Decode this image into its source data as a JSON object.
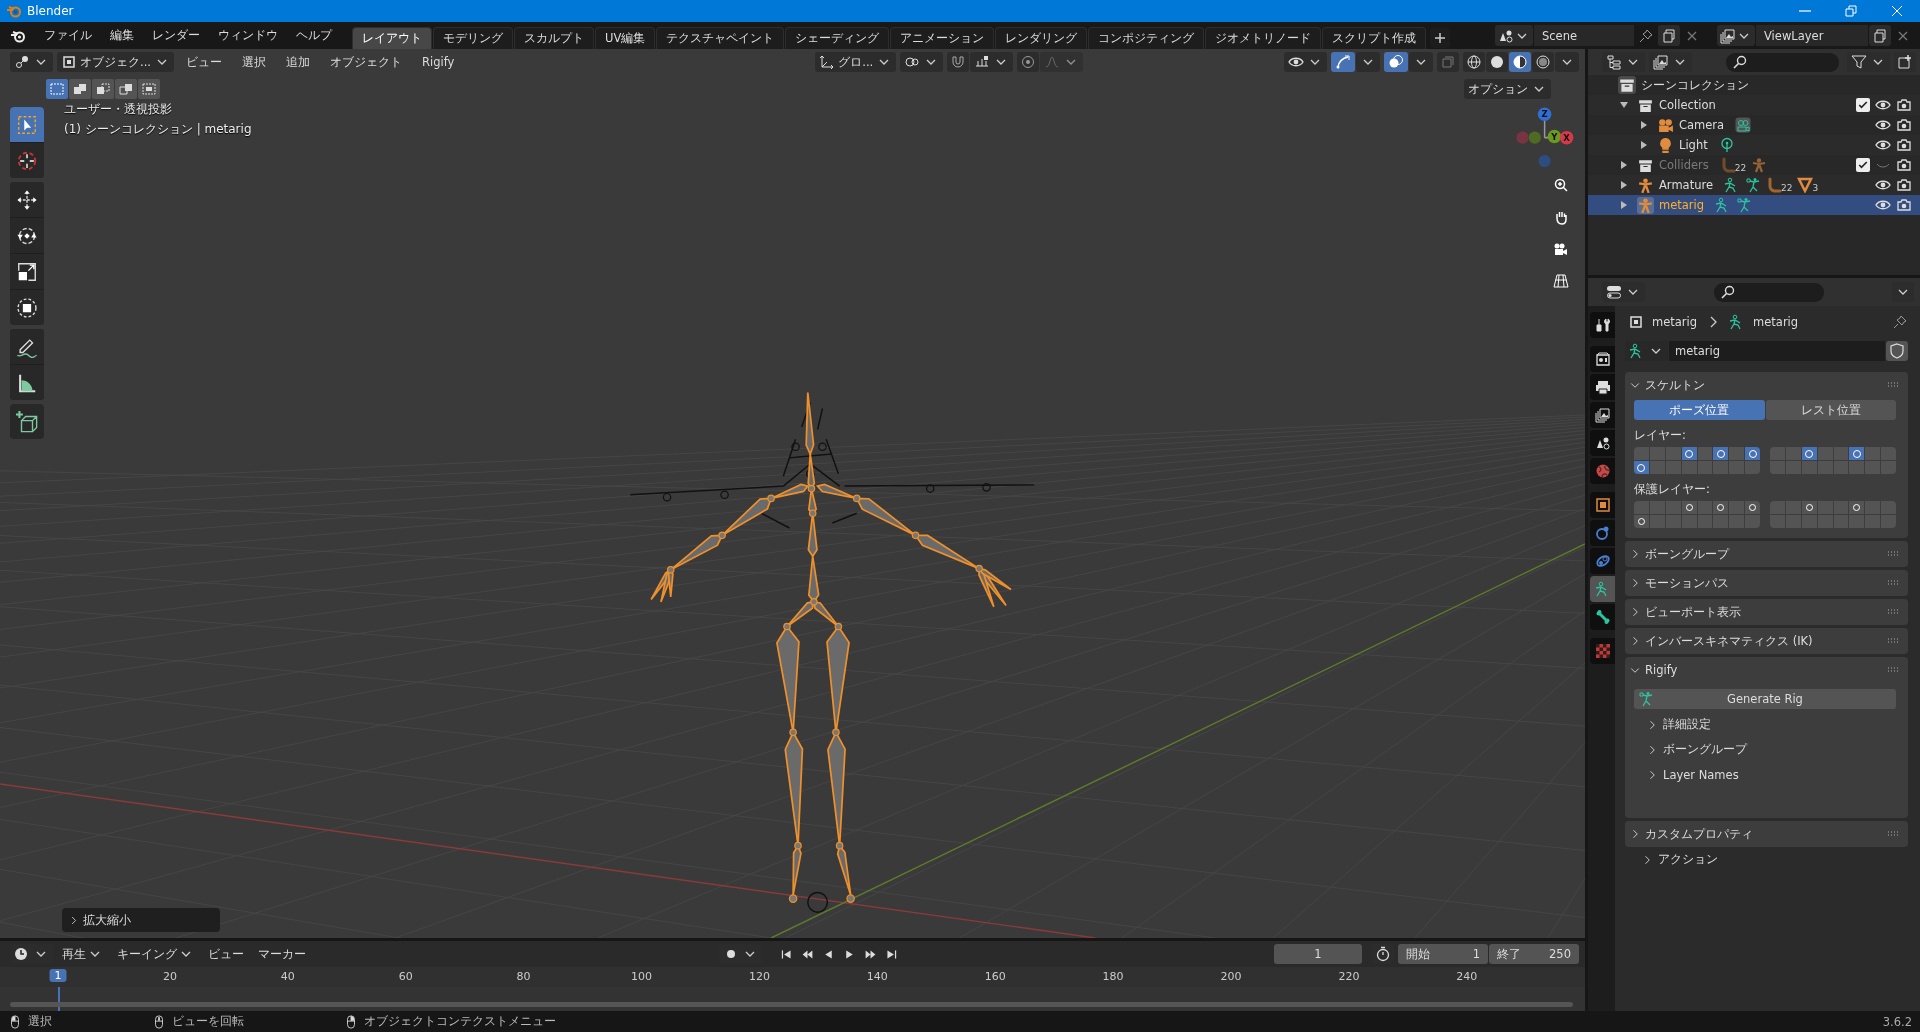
{
  "window": {
    "title": "Blender"
  },
  "menu": [
    "ファイル",
    "編集",
    "レンダー",
    "ウィンドウ",
    "ヘルプ"
  ],
  "workspace_tabs": [
    {
      "label": "レイアウト",
      "selected": true
    },
    {
      "label": "モデリング",
      "selected": false
    },
    {
      "label": "スカルプト",
      "selected": false
    },
    {
      "label": "UV編集",
      "selected": false
    },
    {
      "label": "テクスチャペイント",
      "selected": false
    },
    {
      "label": "シェーディング",
      "selected": false
    },
    {
      "label": "アニメーション",
      "selected": false
    },
    {
      "label": "レンダリング",
      "selected": false
    },
    {
      "label": "コンポジティング",
      "selected": false
    },
    {
      "label": "ジオメトリノード",
      "selected": false
    },
    {
      "label": "スクリプト作成",
      "selected": false
    }
  ],
  "scene": "Scene",
  "view_layer": "ViewLayer",
  "viewport": {
    "mode": "オブジェク...",
    "menus": [
      "ビュー",
      "選択",
      "追加",
      "オブジェクト",
      "Rigify"
    ],
    "orientation": "グロ...",
    "options": "オプション",
    "select_modes": [
      {
        "kind": "new",
        "selected": true
      },
      {
        "kind": "extend",
        "selected": false
      },
      {
        "kind": "subtract",
        "selected": false
      },
      {
        "kind": "invert",
        "selected": false
      },
      {
        "kind": "intersect",
        "selected": false
      }
    ],
    "shading_modes": [
      {
        "kind": "wireframe",
        "selected": false
      },
      {
        "kind": "solid",
        "selected": false
      },
      {
        "kind": "material",
        "selected": true
      },
      {
        "kind": "rendered",
        "selected": false
      }
    ],
    "view_name": "ユーザー・透視投影",
    "context": "(1) シーンコレクション | metarig",
    "last_operator": "拡大縮小",
    "gizmo_axes": [
      {
        "label": "Z",
        "color": "#2f6fd6"
      },
      {
        "label": "Y",
        "color": "#6a9a1f"
      },
      {
        "label": "X",
        "color": "#d63a4a"
      }
    ],
    "tool_groups": [
      [
        {
          "kind": "select",
          "selected": true
        },
        {
          "kind": "cursor",
          "selected": false
        }
      ],
      [
        {
          "kind": "move",
          "selected": false
        },
        {
          "kind": "rotate",
          "selected": false
        },
        {
          "kind": "scale",
          "selected": false
        },
        {
          "kind": "transform",
          "selected": false
        }
      ],
      [
        {
          "kind": "annotate",
          "selected": false
        },
        {
          "kind": "measure",
          "selected": false
        }
      ],
      [
        {
          "kind": "add-cube",
          "selected": false
        }
      ]
    ]
  },
  "outliner": {
    "root": "シーンコレクション",
    "items": [
      {
        "name": "Collection",
        "kind": "collection",
        "expanded": true,
        "selected": false,
        "disabled": false,
        "checked": true,
        "visible": true,
        "children": [
          {
            "name": "Camera",
            "kind": "camera",
            "expanded": false,
            "selected": false,
            "disabled": false,
            "visible": true,
            "badges": [
              {
                "kind": "camera-data"
              }
            ]
          },
          {
            "name": "Light",
            "kind": "light",
            "expanded": false,
            "selected": false,
            "disabled": false,
            "visible": true,
            "badges": [
              {
                "kind": "light-data"
              }
            ]
          }
        ]
      },
      {
        "name": "Colliders",
        "kind": "collection",
        "expanded": false,
        "selected": false,
        "disabled": true,
        "checked": true,
        "visible": false,
        "badges": [
          {
            "kind": "bone",
            "count": "22"
          },
          {
            "kind": "armature"
          }
        ]
      },
      {
        "name": "Armature",
        "kind": "armature",
        "expanded": false,
        "selected": false,
        "disabled": false,
        "visible": true,
        "badges": [
          {
            "kind": "armature-data"
          },
          {
            "kind": "pose"
          },
          {
            "kind": "bone",
            "count": "22"
          },
          {
            "kind": "mesh",
            "count": "3"
          }
        ]
      },
      {
        "name": "metarig",
        "kind": "armature",
        "expanded": false,
        "selected": true,
        "disabled": false,
        "visible": true,
        "badges": [
          {
            "kind": "armature-data"
          },
          {
            "kind": "pose"
          }
        ]
      }
    ]
  },
  "properties": {
    "tab_groups": [
      [
        {
          "kind": "tool",
          "selected": false
        }
      ],
      [
        {
          "kind": "render",
          "selected": false
        },
        {
          "kind": "output",
          "selected": false
        },
        {
          "kind": "view-layer",
          "selected": false
        },
        {
          "kind": "scene",
          "selected": false
        },
        {
          "kind": "world",
          "selected": false
        }
      ],
      [
        {
          "kind": "object",
          "selected": false
        },
        {
          "kind": "physics",
          "selected": false
        },
        {
          "kind": "constraints",
          "selected": false
        },
        {
          "kind": "armature-data",
          "selected": true
        },
        {
          "kind": "bone",
          "selected": false
        }
      ],
      [
        {
          "kind": "texture",
          "selected": false
        }
      ]
    ],
    "breadcrumb": [
      "metarig",
      "metarig"
    ],
    "datablock": "metarig",
    "panels": [
      {
        "kind": "skeleton",
        "label": "スケルトン",
        "expanded": true,
        "position_toggle": [
          {
            "label": "ポーズ位置",
            "selected": true
          },
          {
            "label": "レスト位置",
            "selected": false
          }
        ],
        "layers_label": "レイヤー:",
        "layers": [
          [
            {
              "on": false,
              "used": false
            },
            {
              "on": false,
              "used": false
            },
            {
              "on": false,
              "used": false
            },
            {
              "on": true,
              "used": true
            },
            {
              "on": false,
              "used": false
            },
            {
              "on": true,
              "used": true
            },
            {
              "on": false,
              "used": false
            },
            {
              "on": true,
              "used": true
            },
            {
              "on": true,
              "used": true
            },
            {
              "on": false,
              "used": false
            },
            {
              "on": false,
              "used": false
            },
            {
              "on": false,
              "used": false
            },
            {
              "on": false,
              "used": false
            },
            {
              "on": false,
              "used": false
            },
            {
              "on": false,
              "used": false
            },
            {
              "on": false,
              "used": false
            }
          ],
          [
            {
              "on": false,
              "used": false
            },
            {
              "on": false,
              "used": false
            },
            {
              "on": true,
              "used": true
            },
            {
              "on": false,
              "used": false
            },
            {
              "on": false,
              "used": false
            },
            {
              "on": true,
              "used": true
            },
            {
              "on": false,
              "used": false
            },
            {
              "on": false,
              "used": false
            },
            {
              "on": false,
              "used": false
            },
            {
              "on": false,
              "used": false
            },
            {
              "on": false,
              "used": false
            },
            {
              "on": false,
              "used": false
            },
            {
              "on": false,
              "used": false
            },
            {
              "on": false,
              "used": false
            },
            {
              "on": false,
              "used": false
            },
            {
              "on": false,
              "used": false
            }
          ]
        ],
        "protected_label": "保護レイヤー:",
        "protected_layers": [
          [
            {
              "on": false,
              "used": false
            },
            {
              "on": false,
              "used": false
            },
            {
              "on": false,
              "used": false
            },
            {
              "on": false,
              "used": true
            },
            {
              "on": false,
              "used": false
            },
            {
              "on": false,
              "used": true
            },
            {
              "on": false,
              "used": false
            },
            {
              "on": false,
              "used": true
            },
            {
              "on": false,
              "used": true
            },
            {
              "on": false,
              "used": false
            },
            {
              "on": false,
              "used": false
            },
            {
              "on": false,
              "used": false
            },
            {
              "on": false,
              "used": false
            },
            {
              "on": false,
              "used": false
            },
            {
              "on": false,
              "used": false
            },
            {
              "on": false,
              "used": false
            }
          ],
          [
            {
              "on": false,
              "used": false
            },
            {
              "on": false,
              "used": false
            },
            {
              "on": false,
              "used": true
            },
            {
              "on": false,
              "used": false
            },
            {
              "on": false,
              "used": false
            },
            {
              "on": false,
              "used": true
            },
            {
              "on": false,
              "used": false
            },
            {
              "on": false,
              "used": false
            },
            {
              "on": false,
              "used": false
            },
            {
              "on": false,
              "used": false
            },
            {
              "on": false,
              "used": false
            },
            {
              "on": false,
              "used": false
            },
            {
              "on": false,
              "used": false
            },
            {
              "on": false,
              "used": false
            },
            {
              "on": false,
              "used": false
            },
            {
              "on": false,
              "used": false
            }
          ]
        ]
      },
      {
        "kind": "plain",
        "label": "ボーングループ",
        "expanded": false
      },
      {
        "kind": "plain",
        "label": "モーションパス",
        "expanded": false
      },
      {
        "kind": "plain",
        "label": "ビューポート表示",
        "expanded": false
      },
      {
        "kind": "plain",
        "label": "インバースキネマティクス (IK)",
        "expanded": false
      },
      {
        "kind": "rigify",
        "label": "Rigify",
        "expanded": true,
        "button": "Generate Rig",
        "subpanels": [
          {
            "label": "詳細設定",
            "expanded": false
          },
          {
            "label": "ボーングループ",
            "expanded": false
          },
          {
            "label": "Layer Names",
            "expanded": false
          }
        ]
      },
      {
        "kind": "plain",
        "label": "カスタムプロパティ",
        "expanded": false
      },
      {
        "kind": "subpanel",
        "label": "アクション",
        "expanded": false
      }
    ]
  },
  "timeline": {
    "menus": [
      "再生",
      "キーイング",
      "ビュー",
      "マーカー"
    ],
    "current_frame": "1",
    "start_label": "開始",
    "start": "1",
    "end_label": "終了",
    "end": "250",
    "playhead": "1",
    "ruler": [
      "20",
      "40",
      "60",
      "80",
      "100",
      "120",
      "140",
      "160",
      "180",
      "200",
      "220",
      "240"
    ]
  },
  "status_bar": {
    "items": [
      {
        "kind": "left-mouse",
        "label": "選択"
      },
      {
        "kind": "middle-mouse",
        "label": "ビューを回転"
      },
      {
        "kind": "right-mouse",
        "label": "オブジェクトコンテクストメニュー"
      }
    ],
    "version": "3.6.2"
  }
}
